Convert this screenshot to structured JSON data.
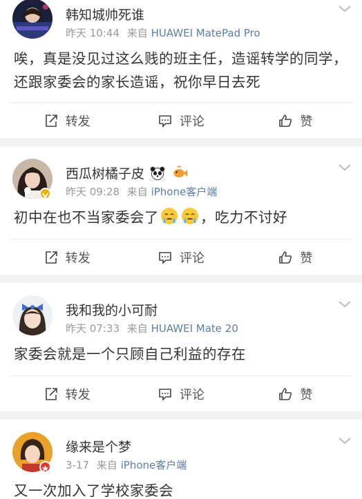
{
  "actions": {
    "repost": "转发",
    "comment": "评论",
    "like": "赞"
  },
  "posts": [
    {
      "username": "韩知城帅死谁",
      "time": "昨天 10:44",
      "source_prefix": "来自",
      "device": "HUAWEI MatePad Pro",
      "content": "唉，真是没见过这么贱的班主任，造谣转学的同学，还跟家委会的家长造谣，祝你早日去死"
    },
    {
      "username": "西瓜树橘子皮",
      "username_emojis": [
        "panda-emoji",
        "fish-emoji"
      ],
      "time": "昨天 09:28",
      "source_prefix": "来自",
      "device": "iPhone客户端",
      "verified_badge": "gold-v-badge",
      "content_before": "初中在也不当家委会了",
      "content_emojis": [
        "crying-face-emoji",
        "crying-face-emoji"
      ],
      "content_after": "，吃力不讨好"
    },
    {
      "username": "我和我的小可耐",
      "time": "昨天 07:33",
      "source_prefix": "来自",
      "device": "HUAWEI Mate 20",
      "content": "家委会就是一个只顾自己利益的存在"
    },
    {
      "username": "缘来是个梦",
      "time": "3-17",
      "source_prefix": "来自",
      "device": "iPhone客户端",
      "verified_badge": "red-star-badge",
      "content": "又一次加入了学校家委会"
    }
  ],
  "colors": {
    "link": "#5b7ea8",
    "meta": "#999999",
    "background": "#f2f2f2"
  }
}
